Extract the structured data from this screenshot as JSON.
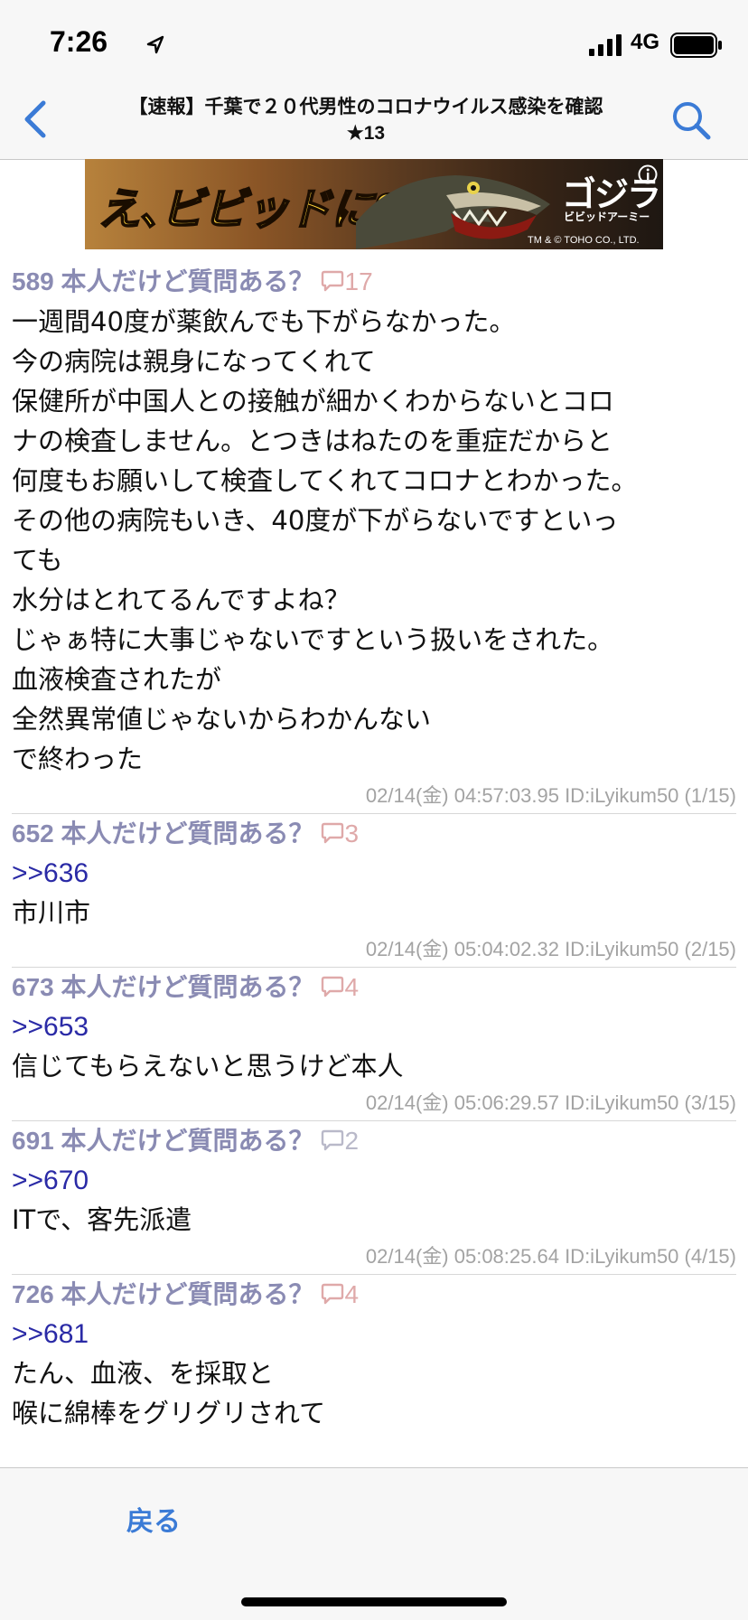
{
  "status_bar": {
    "time": "7:26",
    "network": "4G"
  },
  "nav": {
    "title_line1": "【速報】千葉で２０代男性のコロナウイルス感染を確認",
    "title_line2": "★13"
  },
  "ad": {
    "main_text": "え､ビビッドに?",
    "logo": "ゴジラ",
    "sub": "ビビッドアーミー",
    "copyright": "TM & © TOHO CO., LTD."
  },
  "posts": [
    {
      "number": "589",
      "name": "本人だけど質問ある？",
      "comments": "17",
      "reply": "",
      "lines": [
        "一週間40度が薬飲んでも下がらなかった。",
        "今の病院は親身になってくれて",
        "保健所が中国人との接触が細かくわからないとコロ",
        "ナの検査しません。とつきはねたのを重症だからと",
        "何度もお願いして検査してくれてコロナとわかった。",
        "その他の病院もいき、40度が下がらないですといっ",
        "ても",
        "水分はとれてるんですよね？",
        "じゃぁ特に大事じゃないですという扱いをされた。",
        "血液検査されたが",
        "全然異常値じゃないからわかんない",
        "で終わった"
      ],
      "meta": "02/14(金) 04:57:03.95 ID:iLyikum50 (1/15)"
    },
    {
      "number": "652",
      "name": "本人だけど質問ある？",
      "comments": "3",
      "reply": ">>636",
      "lines": [
        "市川市"
      ],
      "meta": "02/14(金) 05:04:02.32 ID:iLyikum50 (2/15)"
    },
    {
      "number": "673",
      "name": "本人だけど質問ある？",
      "comments": "4",
      "reply": ">>653",
      "lines": [
        "信じてもらえないと思うけど本人"
      ],
      "meta": "02/14(金) 05:06:29.57 ID:iLyikum50 (3/15)"
    },
    {
      "number": "691",
      "name": "本人だけど質問ある？",
      "comments": "2",
      "reply": ">>670",
      "lines": [
        "ITで、客先派遣"
      ],
      "meta": "02/14(金) 05:08:25.64 ID:iLyikum50 (4/15)"
    },
    {
      "number": "726",
      "name": "本人だけど質問ある？",
      "comments": "4",
      "reply": ">>681",
      "lines": [
        "たん、血液、を採取と",
        "喉に綿棒をグリグリされて"
      ],
      "meta": ""
    }
  ],
  "toolbar": {
    "back_label": "戻る"
  },
  "colors": {
    "header_purple": "#8a8bb3",
    "comment_pink": "#dfa9a9",
    "reply_blue": "#2a2aa6",
    "ios_blue": "#3b7bd6"
  }
}
